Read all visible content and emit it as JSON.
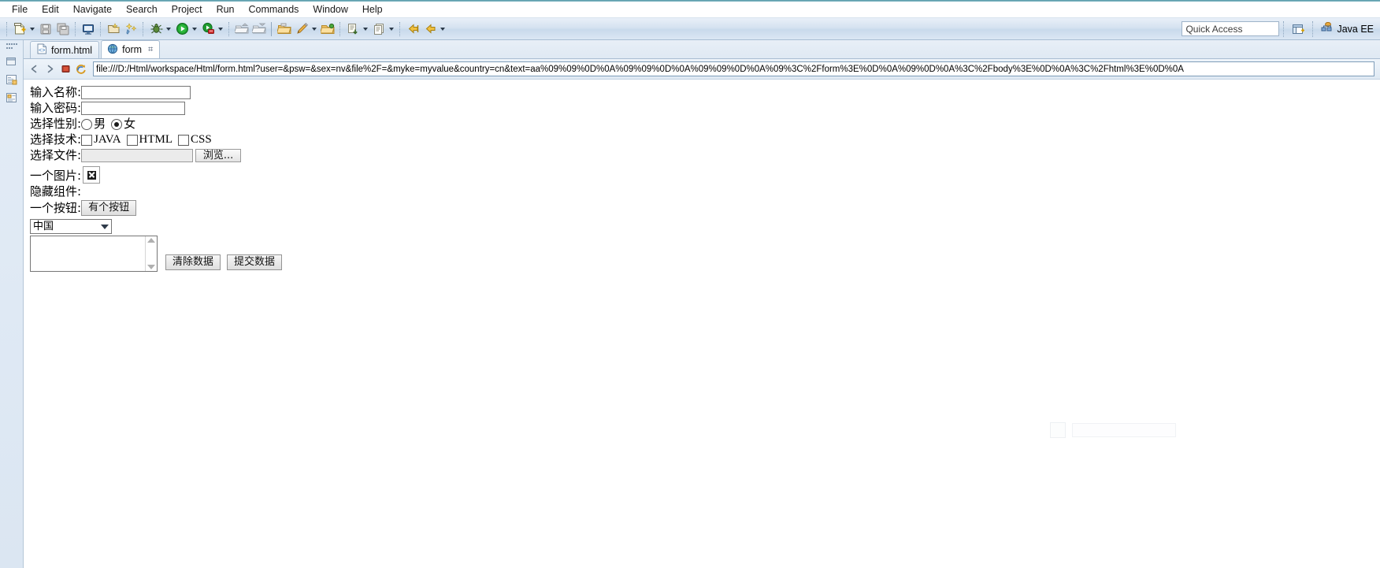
{
  "menu": {
    "items": [
      "File",
      "Edit",
      "Navigate",
      "Search",
      "Project",
      "Run",
      "Commands",
      "Window",
      "Help"
    ]
  },
  "toolbar": {
    "quick_access_label": "Quick Access",
    "perspective_label": "Java EE",
    "icons": [
      "new-file-icon",
      "new-dropdown-arrow",
      "save-icon",
      "save-all-icon",
      "console-icon",
      "new-wizard-icon",
      "quick-fix-icon",
      "debug-icon",
      "debug-dropdown-arrow",
      "run-icon",
      "run-dropdown-arrow",
      "run-server-icon",
      "run-server-dropdown-arrow",
      "export-icon",
      "import-icon",
      "open-folder-icon",
      "edit-pencil-icon",
      "edit-dropdown-arrow",
      "open-project-icon",
      "import-resource-icon",
      "import-dropdown-arrow",
      "next-annotation-icon",
      "next-dropdown-arrow",
      "back-icon",
      "forward-icon",
      "prev-edit-icon",
      "prev-dropdown-arrow",
      "next-edit-icon",
      "next-edit-dropdown-arrow",
      "last-edit-icon",
      "last-edit-dropdown-arrow",
      "open-perspective-icon",
      "perspective-java-ee-icon"
    ]
  },
  "fastview": {
    "icons": [
      "restore-icon",
      "package-explorer-icon",
      "project-explorer-icon"
    ]
  },
  "tabs": [
    {
      "label": "form.html",
      "icon": "html-file-icon",
      "active": false,
      "closable": false
    },
    {
      "label": "form",
      "icon": "globe-icon",
      "active": true,
      "closable": true,
      "close_glyph": "⌗"
    }
  ],
  "browser": {
    "nav_icons": [
      "back-arrow-icon",
      "forward-arrow-icon",
      "stop-icon",
      "refresh-icon"
    ],
    "url": "file:///D:/Html/workspace/Html/form.html?user=&psw=&sex=nv&file%2F=&myke=myvalue&country=cn&text=aa%09%09%0D%0A%09%09%0D%0A%09%09%0D%0A%09%3C%2Fform%3E%0D%0A%09%0D%0A%3C%2Fbody%3E%0D%0A%3C%2Fhtml%3E%0D%0A"
  },
  "form": {
    "rows": {
      "name": {
        "label": "输入名称:",
        "value": ""
      },
      "pass": {
        "label": "输入密码:",
        "value": ""
      },
      "sex": {
        "label": "选择性别:",
        "options": [
          {
            "text": "男",
            "checked": false
          },
          {
            "text": "女",
            "checked": true
          }
        ]
      },
      "tech": {
        "label": "选择技术:",
        "options": [
          {
            "text": "JAVA",
            "checked": false
          },
          {
            "text": "HTML",
            "checked": false
          },
          {
            "text": "CSS",
            "checked": false
          }
        ]
      },
      "file": {
        "label": "选择文件:",
        "value": "",
        "button": "浏览..."
      },
      "image": {
        "label": "一个图片:",
        "icon": "broken-image-icon"
      },
      "hidden": {
        "label": "隐藏组件:"
      },
      "button": {
        "label": "一个按钮:",
        "button": "有个按钮"
      }
    },
    "country_select": {
      "value": "中国"
    },
    "textarea": {
      "value": ""
    },
    "actions": {
      "clear": "清除数据",
      "submit": "提交数据"
    }
  }
}
